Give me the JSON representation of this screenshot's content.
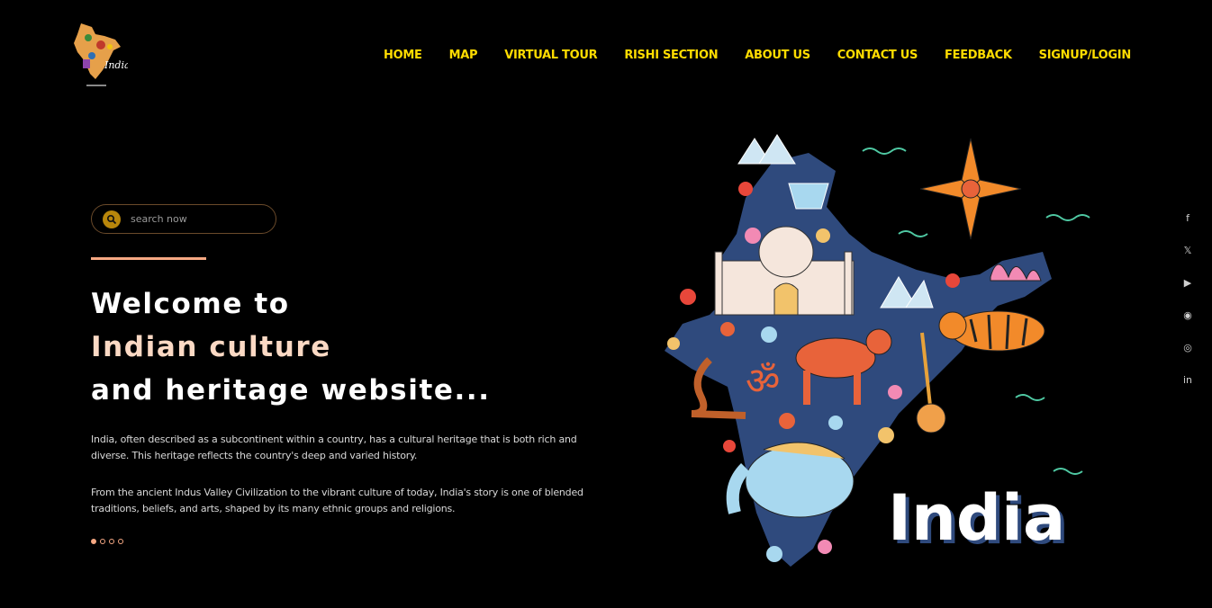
{
  "logo": {
    "alt": "India",
    "text": "India",
    "icon": "india-map-logo-icon"
  },
  "nav": {
    "items": [
      {
        "label": "HOME"
      },
      {
        "label": "MAP"
      },
      {
        "label": "VIRTUAL TOUR"
      },
      {
        "label": "RISHI SECTION"
      },
      {
        "label": "ABOUT US"
      },
      {
        "label": "CONTACT US"
      },
      {
        "label": "FEEDBACK"
      },
      {
        "label": "SIGNUP/LOGIN"
      }
    ],
    "color": "#ffdc00"
  },
  "search": {
    "placeholder": "search now",
    "icon": "search-icon"
  },
  "hero": {
    "line1": "Welcome to",
    "line2": "Indian culture",
    "line3": "and heritage website...",
    "accent_color": "#f6a883",
    "paragraph1": "India, often described as a subcontinent within a country, has a cultural heritage that is both rich and diverse. This heritage reflects the country's deep and varied history.",
    "paragraph2": "From the ancient Indus Valley Civilization to the vibrant culture of today, India's story is one of blended traditions, beliefs, and arts, shaped by its many ethnic groups and religions.",
    "slides": {
      "count": 4,
      "active": 1
    }
  },
  "illustration": {
    "caption": "India",
    "icon": "india-culture-map-illustration"
  },
  "social": [
    {
      "name": "facebook-icon",
      "glyph": "f"
    },
    {
      "name": "x-twitter-icon",
      "glyph": "𝕏"
    },
    {
      "name": "youtube-icon",
      "glyph": "▶"
    },
    {
      "name": "discord-icon",
      "glyph": "◉"
    },
    {
      "name": "instagram-icon",
      "glyph": "◎"
    },
    {
      "name": "linkedin-icon",
      "glyph": "in"
    }
  ]
}
